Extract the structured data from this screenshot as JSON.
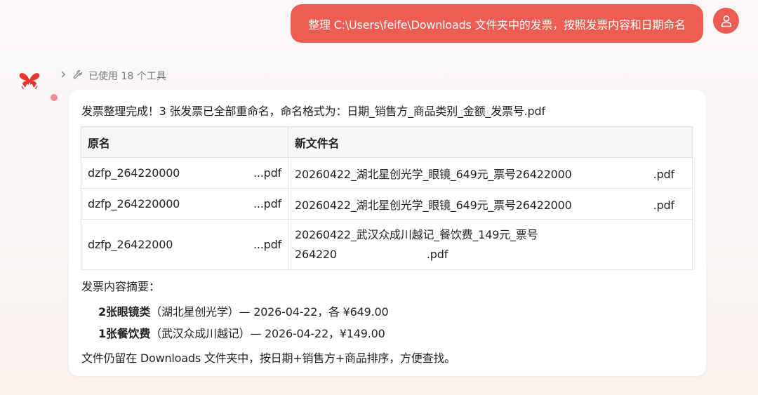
{
  "user_message": {
    "text": "整理 C:\\Users\\feife\\Downloads 文件夹中的发票，按照发票内容和日期命名"
  },
  "tools": {
    "label": "已使用 18 个工具"
  },
  "reply": {
    "intro": "发票整理完成！3 张发票已全部重命名，命名格式为：日期_销售方_商品类别_金额_发票号.pdf",
    "table": {
      "headers": [
        "原名",
        "新文件名"
      ],
      "rows": [
        {
          "orig_prefix": "dzfp_264220000",
          "orig_suffix": "...pdf",
          "new_name": "20260422_湖北星创光学_眼镜_649元_票号26422000",
          "new_suffix": ".pdf"
        },
        {
          "orig_prefix": "dzfp_264220000",
          "orig_suffix": "...pdf",
          "new_name": "20260422_湖北星创光学_眼镜_649元_票号26422000",
          "new_suffix": ".pdf"
        },
        {
          "orig_prefix": "dzfp_26422000",
          "orig_suffix": "...pdf",
          "new_name_line1": "20260422_武汉众成川越记_餐饮费_149元_票号",
          "new_name_line2": "264220",
          "new_suffix": ".pdf"
        }
      ]
    },
    "summary_title": "发票内容摘要：",
    "summary": [
      {
        "bold": "2张眼镜类",
        "rest": "（湖北星创光学）— 2026-04-22，各 ¥649.00"
      },
      {
        "bold": "1张餐饮费",
        "rest": "（武汉众成川越记）— 2026-04-22，¥149.00"
      }
    ],
    "footer": "文件仍留在 Downloads 文件夹中，按日期+销售方+商品排序，方便查找。"
  },
  "colors": {
    "accent": "#ec5c52",
    "card": "#ffffff"
  },
  "icons": {
    "user_avatar": "user-icon",
    "tools": "wrench-icon",
    "expand": "chevron-right-icon",
    "bot": "butterfly-logo-icon"
  }
}
